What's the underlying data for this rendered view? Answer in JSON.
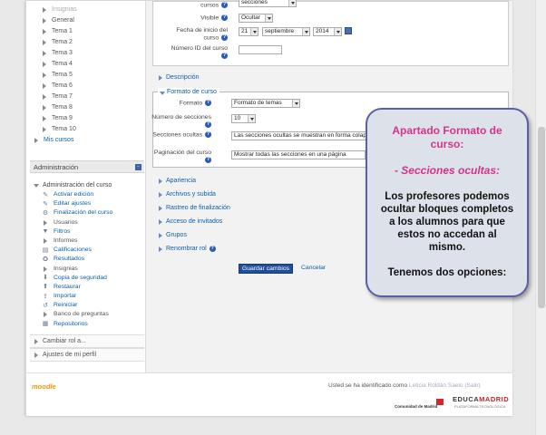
{
  "sidebar": {
    "nav_items": [
      {
        "label": "Insignias",
        "faded": true
      },
      {
        "label": "General"
      },
      {
        "label": "Tema 1"
      },
      {
        "label": "Tema 2"
      },
      {
        "label": "Tema 3"
      },
      {
        "label": "Tema 4"
      },
      {
        "label": "Tema 5"
      },
      {
        "label": "Tema 6"
      },
      {
        "label": "Tema 7"
      },
      {
        "label": "Tema 8"
      },
      {
        "label": "Tema 9"
      },
      {
        "label": "Tema 10"
      }
    ],
    "mis_cursos": "Mis cursos",
    "admin_block_title": "Administración",
    "admin_root": "Administración del curso",
    "admin_items": [
      {
        "label": "Activar edición",
        "icon": "pencil-cross-icon",
        "glyph": "✎"
      },
      {
        "label": "Editar ajustes",
        "icon": "settings-icon",
        "glyph": "✎"
      },
      {
        "label": "Finalización del curso",
        "icon": "settings-icon",
        "glyph": "⚙"
      },
      {
        "label": "Usuarios",
        "icon": "tree-arrow-icon",
        "glyph": "",
        "collapsible": true
      },
      {
        "label": "Filtros",
        "icon": "filter-icon",
        "glyph": "▼"
      },
      {
        "label": "Informes",
        "icon": "tree-arrow-icon",
        "glyph": "",
        "collapsible": true
      },
      {
        "label": "Calificaciones",
        "icon": "grades-icon",
        "glyph": "▤"
      },
      {
        "label": "Resultados",
        "icon": "outcomes-icon",
        "glyph": "✪"
      },
      {
        "label": "Insignias",
        "icon": "tree-arrow-icon",
        "glyph": "",
        "collapsible": true
      },
      {
        "label": "Copia de seguridad",
        "icon": "backup-icon",
        "glyph": "⬇"
      },
      {
        "label": "Restaurar",
        "icon": "restore-icon",
        "glyph": "⬆"
      },
      {
        "label": "Importar",
        "icon": "import-icon",
        "glyph": "⇪"
      },
      {
        "label": "Reiniciar",
        "icon": "reset-icon",
        "glyph": "↺"
      },
      {
        "label": "Banco de preguntas",
        "icon": "tree-arrow-icon",
        "glyph": "",
        "collapsible": true
      },
      {
        "label": "Repositorios",
        "icon": "repository-icon",
        "glyph": "▦"
      }
    ],
    "switch_role": "Cambiar rol a...",
    "profile_settings": "Ajustes de mi perfil"
  },
  "form": {
    "cursos_label": "cursos",
    "cursos_value": "secciones",
    "visible_label": "Visible",
    "visible_value": "Ocultar",
    "start_date_label": "Fecha de inicio del curso",
    "start_day": "21",
    "start_month": "septiembre",
    "start_year": "2014",
    "id_number_label": "Número ID del curso",
    "description_section": "Descripción",
    "course_format_section": "Formato de curso",
    "format_label": "Formato",
    "format_value": "Formato de temas",
    "sections_count_label": "Número de secciones",
    "sections_count_value": "10",
    "hidden_sections_label": "Secciones ocultas",
    "hidden_sections_value": "Las secciones ocultas se muestran en forma colap",
    "pagination_label": "Paginación del curso",
    "pagination_value": "Mostrar todas las secciones en una página",
    "collapsed_sections": [
      "Apariencia",
      "Archivos y subida",
      "Rastreo de finalización",
      "Acceso de invitados",
      "Grupos",
      "Renombrar rol"
    ],
    "save_button": "Guardar cambios",
    "cancel_button": "Cancelar"
  },
  "footer": {
    "moodle_logo": "moodle",
    "login_prefix": "Usted se ha identificado como",
    "user_name": "Leticia Roldán Saelo",
    "logout": "(Salir)",
    "cm_logo_text": "Comunidad de Madrid",
    "em_logo_a": "EDUCA",
    "em_logo_b": "MADRID",
    "em_logo_sub": "PLATAFORMA TECNOLÓGICA"
  },
  "callout": {
    "title": "Apartado Formato de curso:",
    "subtitle": "- Secciones ocultas:",
    "body": "Los profesores podemos ocultar bloques completos a los alumnos para que estos no accedan al mismo.",
    "body2": "Tenemos dos opciones:"
  },
  "colors": {
    "link": "#0a5fa8",
    "callout_pink": "#d4338a",
    "callout_border": "#5b5fa6",
    "primary_button": "#1f4f9c"
  }
}
